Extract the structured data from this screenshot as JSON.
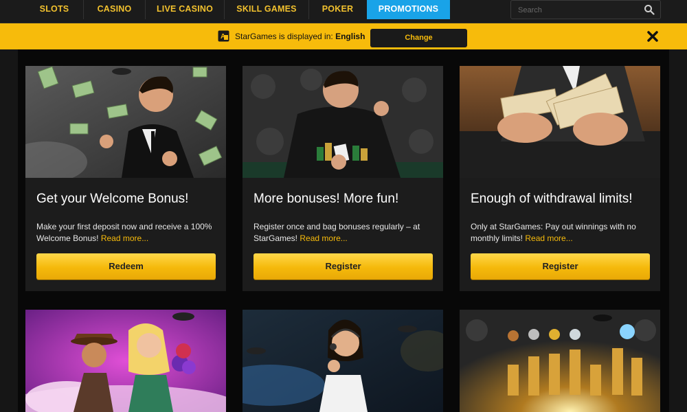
{
  "nav": {
    "items": [
      {
        "label": "SLOTS",
        "active": false
      },
      {
        "label": "CASINO",
        "active": false
      },
      {
        "label": "LIVE CASINO",
        "active": false
      },
      {
        "label": "SKILL GAMES",
        "active": false
      },
      {
        "label": "POKER",
        "active": false
      },
      {
        "label": "PROMOTIONS",
        "active": true
      }
    ],
    "search_placeholder": "Search",
    "search_icon": "magnifier-icon",
    "active_color": "#19a3e8",
    "label_color": "#f2c12e"
  },
  "language_bar": {
    "prefix": "StarGames is displayed in:",
    "language": "English",
    "change_label": "Change",
    "icon": "translate-icon",
    "close_icon": "close-icon",
    "background": "#f7bb0b"
  },
  "promos": [
    {
      "title": "Get your Welcome Bonus!",
      "text": "Make your first deposit now and receive a 100% Welcome Bonus!",
      "more": "Read more...",
      "button": "Redeem"
    },
    {
      "title": "More bonuses! More fun!",
      "text": "Register once and bag bonuses regularly – at StarGames!",
      "more": "Read more...",
      "button": "Register"
    },
    {
      "title": "Enough of withdrawal limits!",
      "text": "Only at StarGames: Pay out winnings with no monthly limits!",
      "more": "Read more...",
      "button": "Register"
    }
  ]
}
